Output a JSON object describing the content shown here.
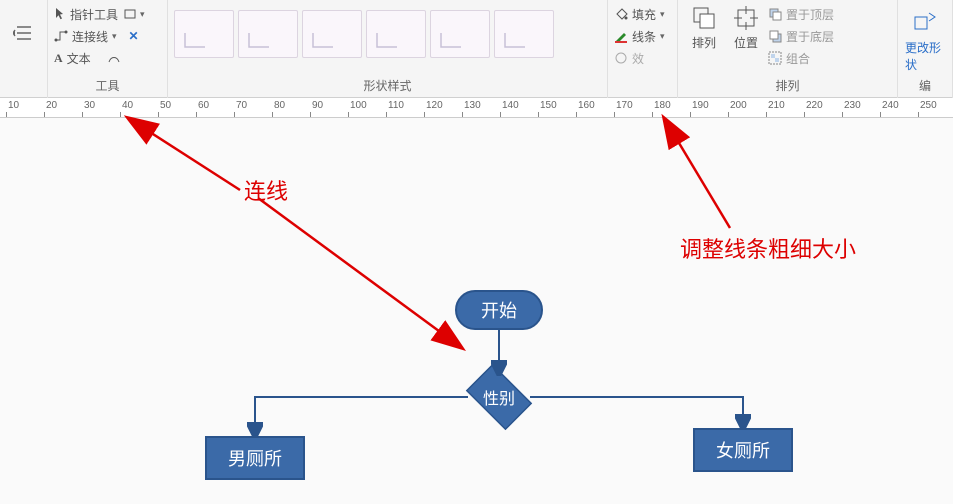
{
  "ribbon": {
    "indent_tooltip": "减少缩进",
    "tools": {
      "pointer": "指针工具",
      "connector": "连接线",
      "text": "文本",
      "group_label": "工具"
    },
    "shape_styles": {
      "group_label": "形状样式"
    },
    "fill_line": {
      "fill": "填充",
      "line": "线条",
      "effect": "效"
    },
    "arrange": {
      "arrange_btn": "排列",
      "position_btn": "位置",
      "bring_front": "置于顶层",
      "send_back": "置于底层",
      "group": "组合",
      "group_label": "排列"
    },
    "change_shape": {
      "label": "更改形状",
      "group_label": "编"
    }
  },
  "ruler": {
    "start": 10,
    "end": 250,
    "step": 10
  },
  "annotations": {
    "connector_hint": "连线",
    "line_hint": "调整线条粗细大小"
  },
  "flow": {
    "start": "开始",
    "decision": "性别",
    "left": "男厕所",
    "right": "女厕所"
  }
}
